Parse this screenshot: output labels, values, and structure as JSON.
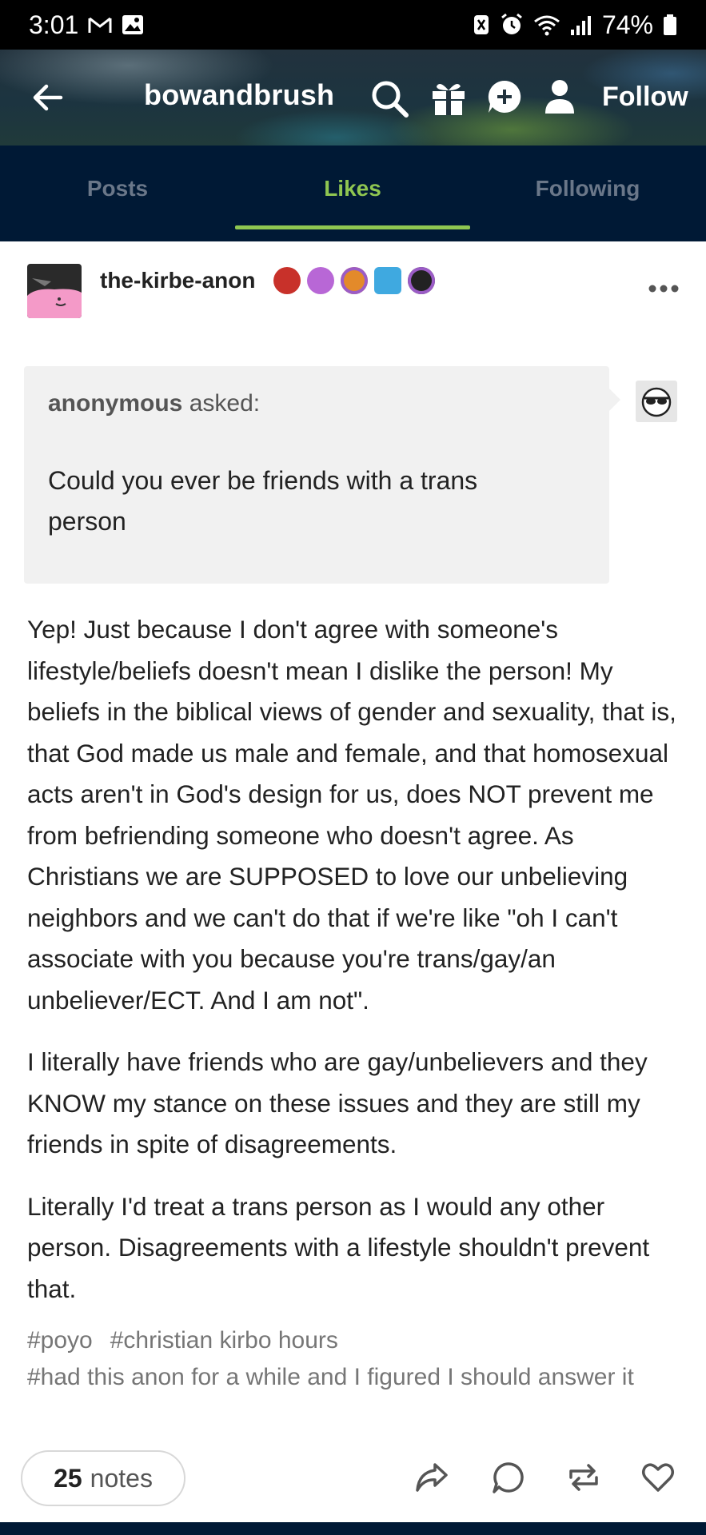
{
  "status_bar": {
    "time": "3:01",
    "battery": "74%"
  },
  "header": {
    "blog_name": "bowandbrush",
    "follow_label": "Follow"
  },
  "tabs": [
    {
      "label": "Posts",
      "active": false
    },
    {
      "label": "Likes",
      "active": true
    },
    {
      "label": "Following",
      "active": false
    }
  ],
  "post": {
    "author": "the-kirbe-anon",
    "badges": [
      "red-hexagon-badge",
      "paw-badge-pink",
      "paw-badge-orange",
      "robot-badge",
      "paw-badge-black"
    ],
    "ask": {
      "asker": "anonymous",
      "asked_label": "asked:",
      "question": "Could you ever be friends with a trans person"
    },
    "paragraphs": [
      "Yep! Just because I don't agree with someone's lifestyle/beliefs doesn't mean I dislike the person! My beliefs in the biblical views of gender and sexuality, that is, that God made us male and female, and that homosexual acts aren't in God's design for us, does NOT prevent me from befriending someone who doesn't agree. As Christians we are SUPPOSED to love our unbelieving neighbors and we can't do that if we're like \"oh I can't associate with you because you're trans/gay/an unbeliever/ECT. And I am not\".",
      "I literally have friends who are gay/unbelievers and they KNOW my stance on these issues and they are still my friends in spite of disagreements.",
      "Literally I'd treat a trans person as I would any other person. Disagreements with a lifestyle shouldn't prevent that."
    ],
    "tags": [
      "#poyo",
      "#christian kirbo hours",
      "#had this anon for a while and I figured I should answer it"
    ],
    "notes_count": "25",
    "notes_label": "notes"
  },
  "colors": {
    "tab_active": "#8fc651",
    "tab_bar_bg": "#001935",
    "ask_bg": "#f1f1f1"
  }
}
